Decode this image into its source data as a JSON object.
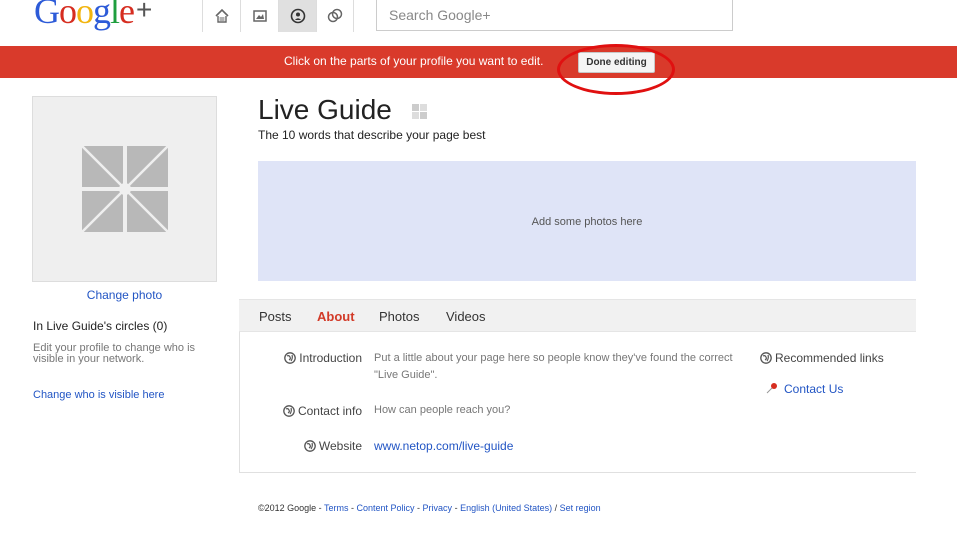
{
  "header": {
    "logo_text": "Google+",
    "search_placeholder": "Search Google+",
    "nav_icons": [
      "home-icon",
      "photos-icon",
      "profile-icon",
      "circles-icon"
    ]
  },
  "banner": {
    "message": "Click on the parts of your profile you want to edit.",
    "done_label": "Done editing",
    "color": "#d93a2b",
    "annotation_color": "#e01010"
  },
  "sidebar": {
    "change_photo": "Change photo",
    "circles_title": "In Live Guide's circles (0)",
    "edit_note": "Edit your profile to change who is visible in your network.",
    "change_visible": "Change who is visible here"
  },
  "profile": {
    "name": "Live Guide",
    "tagline": "The 10 words that describe your page best",
    "photos_prompt": "Add some photos here"
  },
  "tabs": [
    "Posts",
    "About",
    "Photos",
    "Videos"
  ],
  "active_tab": "About",
  "about": {
    "introduction_label": "Introduction",
    "introduction_value": "Put a little about your page here so people know they've found the correct \"Live Guide\".",
    "contact_label": "Contact info",
    "contact_value": "How can people reach you?",
    "website_label": "Website",
    "website_value": "www.netop.com/live-guide",
    "recommended_label": "Recommended links",
    "contact_us": "Contact Us"
  },
  "footer": {
    "copyright": "©2012 Google - ",
    "terms": "Terms",
    "content_policy": "Content Policy",
    "privacy": "Privacy",
    "language": "English (United States)",
    "set_region": "Set region",
    "sep": " - ",
    "slash": " / "
  }
}
